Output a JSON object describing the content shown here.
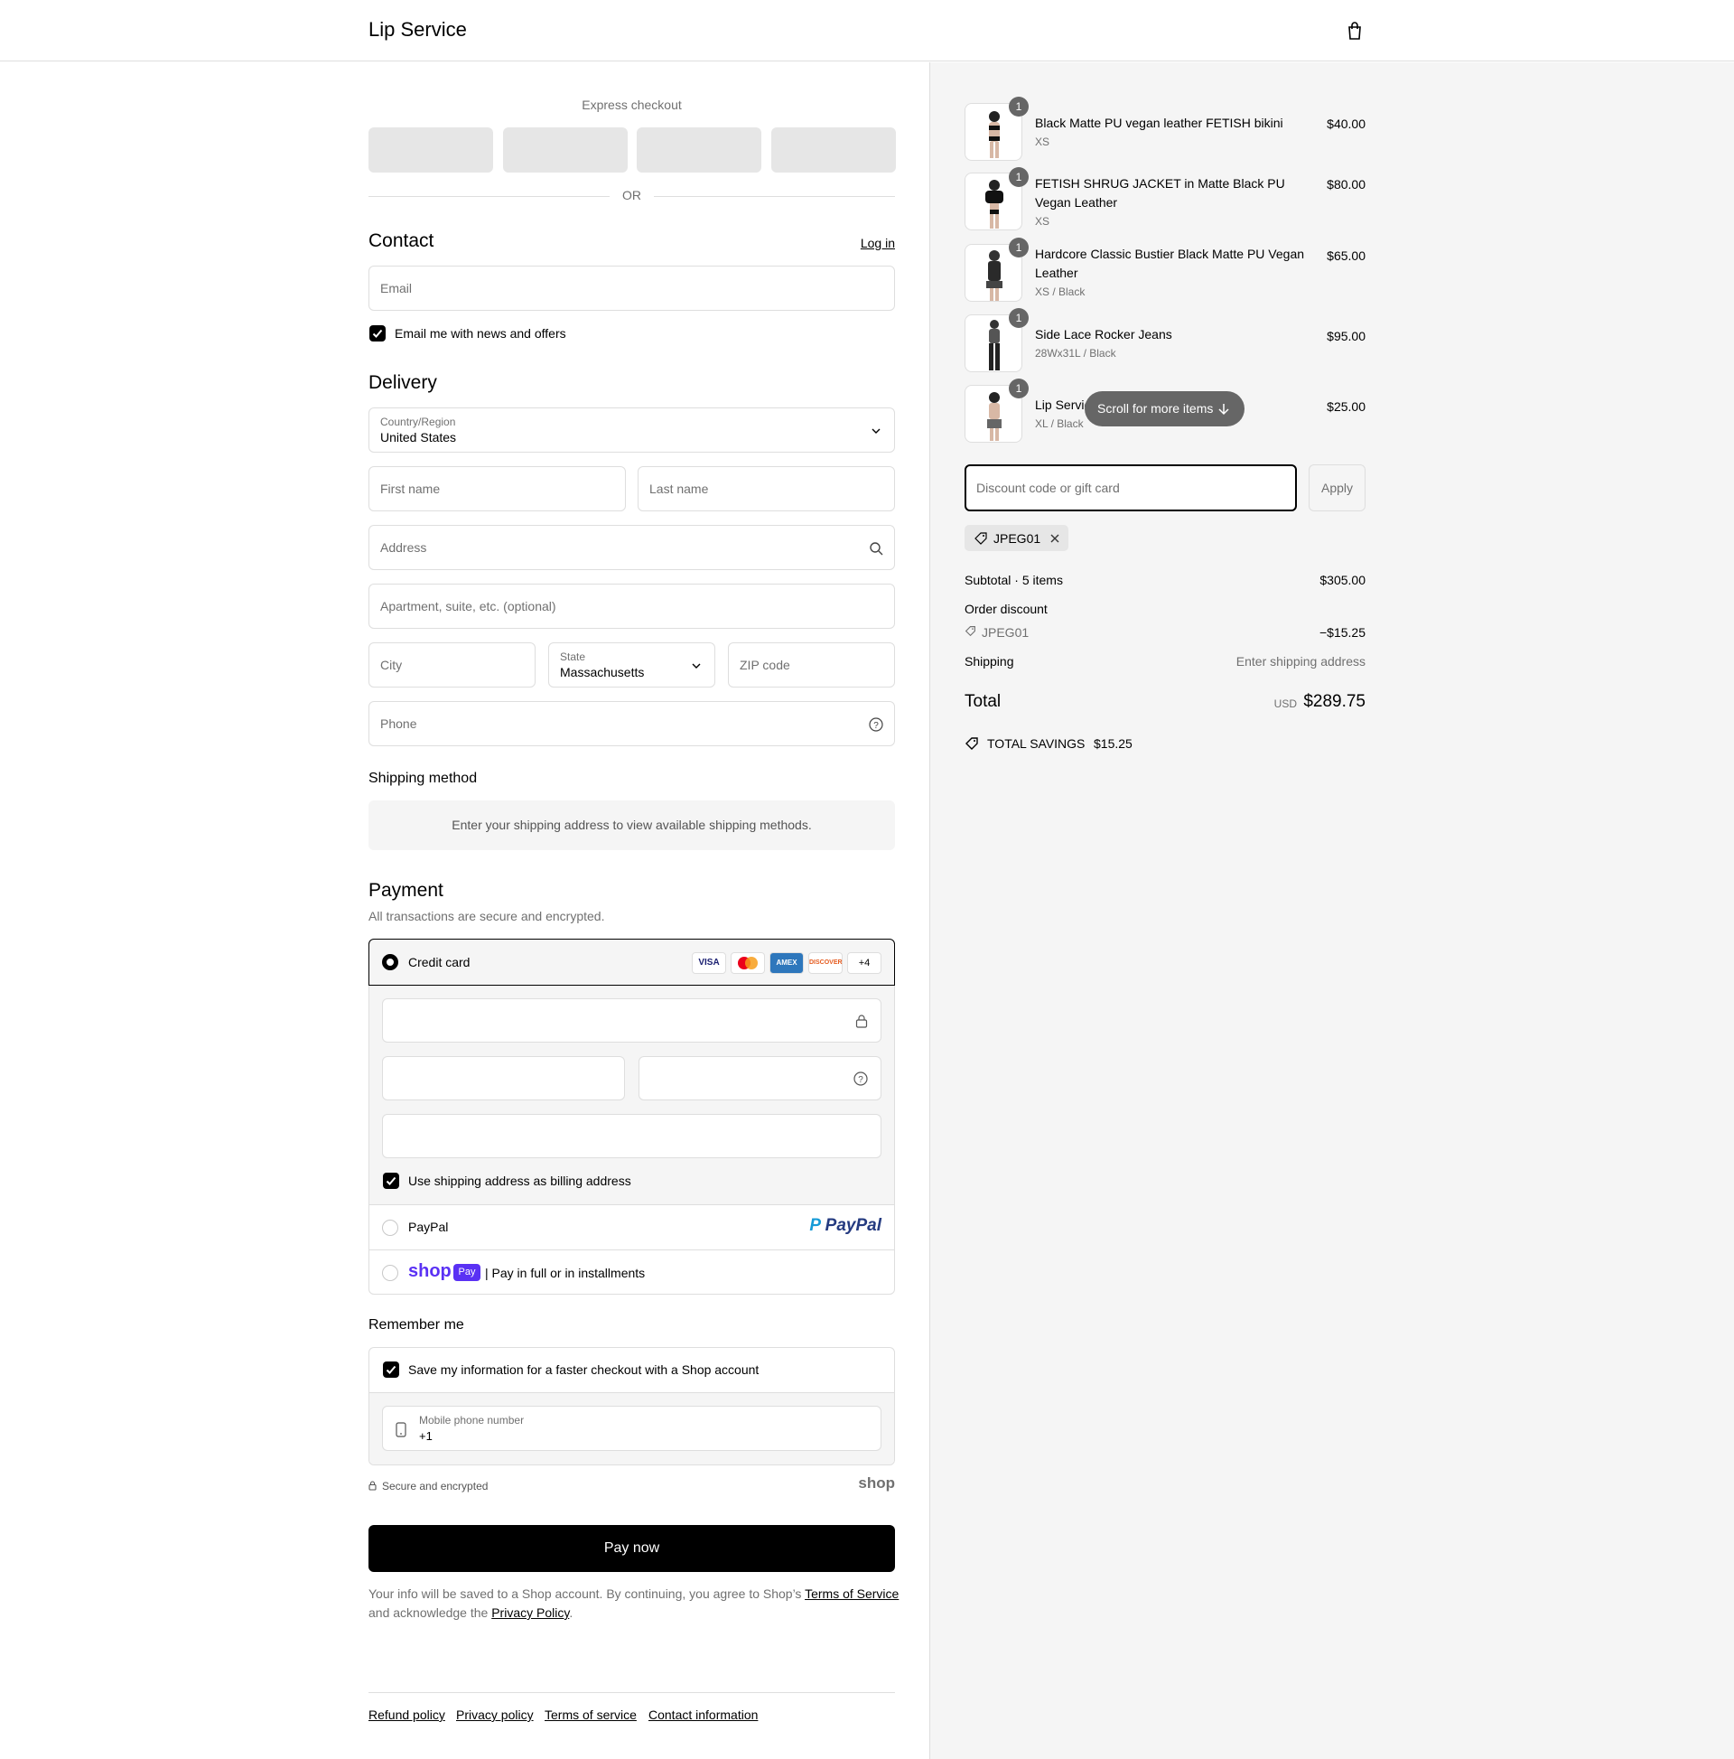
{
  "header": {
    "store_name": "Lip Service",
    "cart_icon": "shopping-bag-icon"
  },
  "express": {
    "label": "Express checkout",
    "or": "OR"
  },
  "contact": {
    "title": "Contact",
    "login": "Log in",
    "email_placeholder": "Email",
    "news_label": "Email me with news and offers",
    "news_checked": true
  },
  "delivery": {
    "title": "Delivery",
    "country_label": "Country/Region",
    "country_value": "United States",
    "first_name": "First name",
    "last_name": "Last name",
    "address": "Address",
    "apartment": "Apartment, suite, etc. (optional)",
    "city": "City",
    "state_label": "State",
    "state_value": "Massachusetts",
    "zip": "ZIP code",
    "phone": "Phone"
  },
  "shipping_method": {
    "title": "Shipping method",
    "message": "Enter your shipping address to view available shipping methods."
  },
  "payment": {
    "title": "Payment",
    "subtitle": "All transactions are secure and encrypted.",
    "credit_card": "Credit card",
    "card_brands": [
      "VISA",
      "MC",
      "AMEX",
      "DISCOVER"
    ],
    "more_brands": "+4",
    "billing_label": "Use shipping address as billing address",
    "paypal_label": "PayPal",
    "paypal_logo": "PayPal",
    "shop_logo": "shop",
    "shop_badge": "Pay",
    "shop_label": "| Pay in full or in installments"
  },
  "remember": {
    "title": "Remember me",
    "save_label": "Save my information for a faster checkout with a Shop account",
    "mobile_label": "Mobile phone number",
    "mobile_value": "+1",
    "secure": "Secure and encrypted",
    "shop_mark": "shop"
  },
  "pay_button": "Pay now",
  "legal": {
    "text1": "Your info will be saved to a Shop account. By continuing, you agree to Shop’s ",
    "terms": "Terms of Service",
    "text2": "and acknowledge the ",
    "privacy": "Privacy Policy",
    "end": "."
  },
  "footer_links": [
    "Refund policy",
    "Privacy policy",
    "Terms of service",
    "Contact information"
  ],
  "cart": {
    "items": [
      {
        "qty": "1",
        "name": "Black Matte PU vegan leather FETISH bikini",
        "variant": "XS",
        "price": "$40.00"
      },
      {
        "qty": "1",
        "name": "FETISH SHRUG JACKET in Matte Black PU Vegan Leather",
        "variant": "XS",
        "price": "$80.00"
      },
      {
        "qty": "1",
        "name": "Hardcore Classic Bustier Black Matte PU Vegan Leather",
        "variant": "XS / Black",
        "price": "$65.00"
      },
      {
        "qty": "1",
        "name": "Side Lace Rocker Jeans",
        "variant": "28Wx31L / Black",
        "price": "$95.00"
      },
      {
        "qty": "1",
        "name": "Lip Servic",
        "variant": "XL / Black",
        "price": "$25.00"
      }
    ],
    "scroll_hint": "Scroll for more items",
    "discount_placeholder": "Discount code or gift card",
    "apply": "Apply",
    "code_tag": "JPEG01",
    "subtotal_label": "Subtotal · 5 items",
    "subtotal": "$305.00",
    "order_discount": "Order discount",
    "discount_code": "JPEG01",
    "discount_amount": "−$15.25",
    "shipping_label": "Shipping",
    "shipping_value": "Enter shipping address",
    "total_label": "Total",
    "currency": "USD",
    "total": "$289.75",
    "savings_label": "TOTAL SAVINGS",
    "savings": "$15.25"
  }
}
